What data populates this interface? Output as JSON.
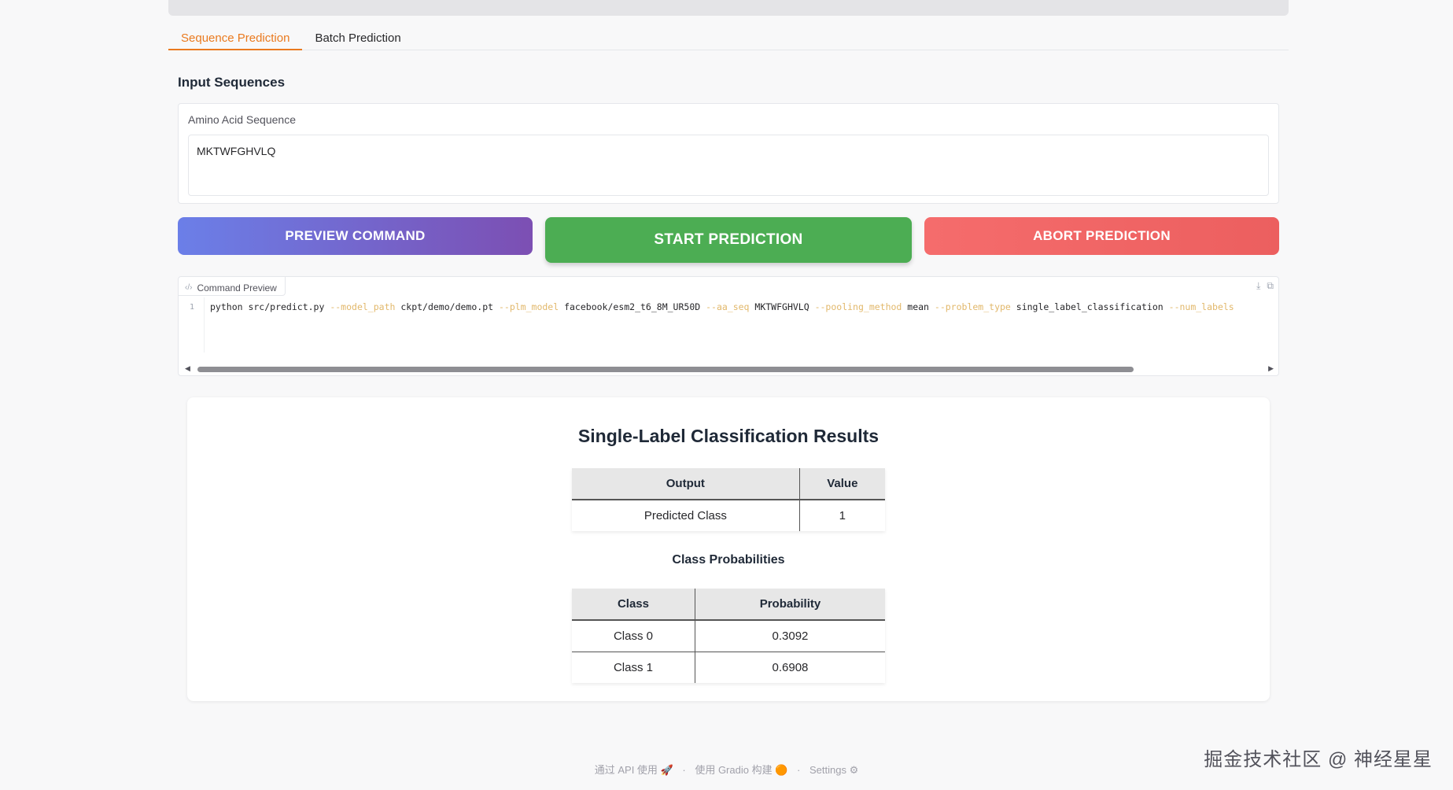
{
  "tabs": [
    {
      "label": "Sequence Prediction",
      "active": true
    },
    {
      "label": "Batch Prediction",
      "active": false
    }
  ],
  "input": {
    "section_title": "Input Sequences",
    "field_label": "Amino Acid Sequence",
    "value": "MKTWFGHVLQ"
  },
  "buttons": {
    "preview": "PREVIEW COMMAND",
    "start": "START PREDICTION",
    "abort": "ABORT PREDICTION"
  },
  "command_preview": {
    "label": "Command Preview",
    "line_number": "1",
    "tokens": [
      {
        "text": "python src/predict.py ",
        "flag": false
      },
      {
        "text": "--model_path",
        "flag": true
      },
      {
        "text": " ckpt/demo/demo.pt ",
        "flag": false
      },
      {
        "text": "--plm_model",
        "flag": true
      },
      {
        "text": " facebook/esm2_t6_8M_UR50D ",
        "flag": false
      },
      {
        "text": "--aa_seq",
        "flag": true
      },
      {
        "text": " MKTWFGHVLQ ",
        "flag": false
      },
      {
        "text": "--pooling_method",
        "flag": true
      },
      {
        "text": " mean ",
        "flag": false
      },
      {
        "text": "--problem_type",
        "flag": true
      },
      {
        "text": " single_label_classification ",
        "flag": false
      },
      {
        "text": "--num_labels",
        "flag": true
      }
    ],
    "scroll_fraction": 0.88
  },
  "results": {
    "title": "Single-Label Classification Results",
    "output_table": {
      "headers": [
        "Output",
        "Value"
      ],
      "rows": [
        [
          "Predicted Class",
          "1"
        ]
      ]
    },
    "probabilities_title": "Class Probabilities",
    "probabilities_table": {
      "headers": [
        "Class",
        "Probability"
      ],
      "rows": [
        [
          "Class 0",
          "0.3092"
        ],
        [
          "Class 1",
          "0.6908"
        ]
      ]
    }
  },
  "footer": {
    "api": "通过 API 使用",
    "api_icon": "🚀",
    "built": "使用 Gradio 构建",
    "built_icon": "🟠",
    "settings": "Settings",
    "settings_icon": "⚙"
  },
  "watermark": "掘金技术社区 @ 神经星星",
  "colors": {
    "accent": "#ea7a1f",
    "start": "#4cad53",
    "abort": "#f56c6c",
    "preview_from": "#6b7fe8",
    "preview_to": "#7c4fb3"
  }
}
